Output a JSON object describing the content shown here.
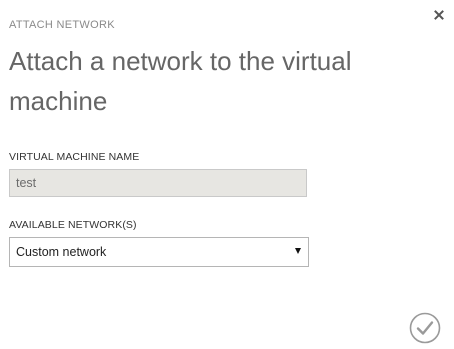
{
  "dialog": {
    "header": "ATTACH NETWORK",
    "title": "Attach a network to the virtual machine",
    "close_icon": "close-icon",
    "confirm_icon": "checkmark-circle-icon"
  },
  "fields": {
    "vm_name": {
      "label": "VIRTUAL MACHINE NAME",
      "value": "test"
    },
    "network": {
      "label": "AVAILABLE NETWORK(S)",
      "selected": "Custom network",
      "arrow_icon": "dropdown-arrow-icon"
    }
  }
}
